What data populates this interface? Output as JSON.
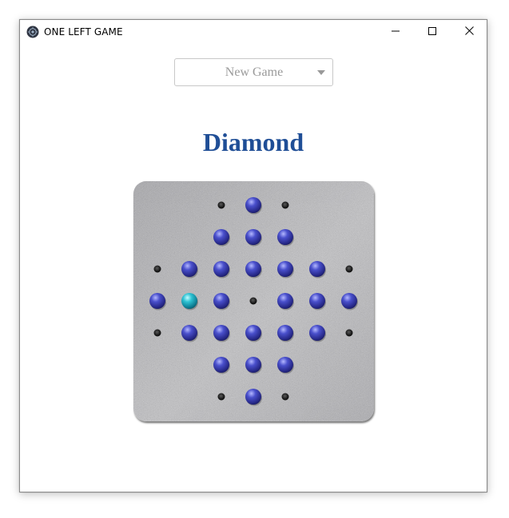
{
  "window": {
    "title": "ONE LEFT GAME",
    "icons": {
      "app": "app-logo-icon",
      "minimize": "minimize-icon",
      "maximize": "maximize-icon",
      "close": "close-icon"
    }
  },
  "toolbar": {
    "game_select_value": "New Game",
    "dropdown_icon": "chevron-down-icon"
  },
  "game": {
    "board_name": "Diamond",
    "grid_size": 7,
    "colors": {
      "title": "#1f4e96",
      "peg": "#3b3fb0",
      "selected_peg": "#2bb8c8",
      "hole": "#1a1a1a",
      "board": "#b9b9be"
    },
    "cells": [
      {
        "row": 0,
        "col": 2,
        "state": "hole"
      },
      {
        "row": 0,
        "col": 3,
        "state": "peg"
      },
      {
        "row": 0,
        "col": 4,
        "state": "hole"
      },
      {
        "row": 1,
        "col": 2,
        "state": "peg"
      },
      {
        "row": 1,
        "col": 3,
        "state": "peg"
      },
      {
        "row": 1,
        "col": 4,
        "state": "peg"
      },
      {
        "row": 2,
        "col": 0,
        "state": "hole"
      },
      {
        "row": 2,
        "col": 1,
        "state": "peg"
      },
      {
        "row": 2,
        "col": 2,
        "state": "peg"
      },
      {
        "row": 2,
        "col": 3,
        "state": "peg"
      },
      {
        "row": 2,
        "col": 4,
        "state": "peg"
      },
      {
        "row": 2,
        "col": 5,
        "state": "peg"
      },
      {
        "row": 2,
        "col": 6,
        "state": "hole"
      },
      {
        "row": 3,
        "col": 0,
        "state": "peg"
      },
      {
        "row": 3,
        "col": 1,
        "state": "selected"
      },
      {
        "row": 3,
        "col": 2,
        "state": "peg"
      },
      {
        "row": 3,
        "col": 3,
        "state": "hole"
      },
      {
        "row": 3,
        "col": 4,
        "state": "peg"
      },
      {
        "row": 3,
        "col": 5,
        "state": "peg"
      },
      {
        "row": 3,
        "col": 6,
        "state": "peg"
      },
      {
        "row": 4,
        "col": 0,
        "state": "hole"
      },
      {
        "row": 4,
        "col": 1,
        "state": "peg"
      },
      {
        "row": 4,
        "col": 2,
        "state": "peg"
      },
      {
        "row": 4,
        "col": 3,
        "state": "peg"
      },
      {
        "row": 4,
        "col": 4,
        "state": "peg"
      },
      {
        "row": 4,
        "col": 5,
        "state": "peg"
      },
      {
        "row": 4,
        "col": 6,
        "state": "hole"
      },
      {
        "row": 5,
        "col": 2,
        "state": "peg"
      },
      {
        "row": 5,
        "col": 3,
        "state": "peg"
      },
      {
        "row": 5,
        "col": 4,
        "state": "peg"
      },
      {
        "row": 6,
        "col": 2,
        "state": "hole"
      },
      {
        "row": 6,
        "col": 3,
        "state": "peg"
      },
      {
        "row": 6,
        "col": 4,
        "state": "hole"
      }
    ]
  }
}
